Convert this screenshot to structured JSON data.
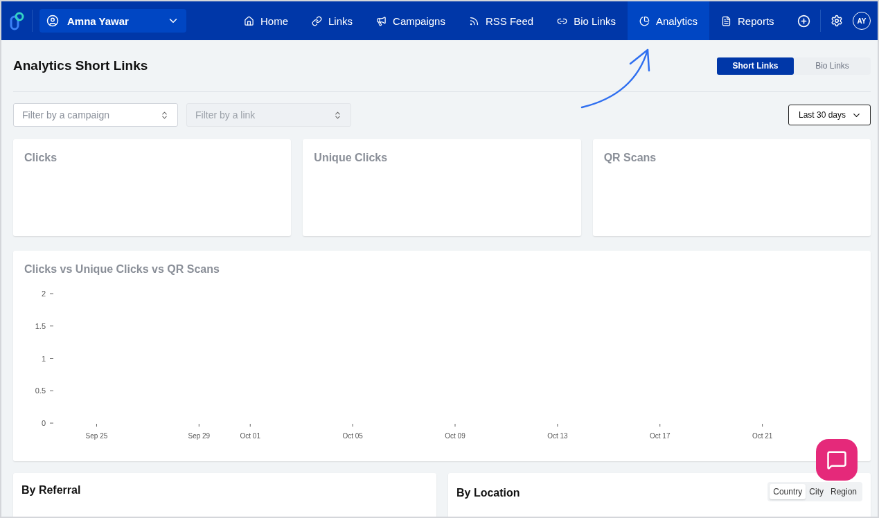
{
  "nav": {
    "account": "Amna Yawar",
    "avatar": "AY",
    "items": [
      {
        "label": "Home",
        "selected": false
      },
      {
        "label": "Links",
        "selected": false
      },
      {
        "label": "Campaigns",
        "selected": false
      },
      {
        "label": "RSS Feed",
        "selected": false
      },
      {
        "label": "Bio Links",
        "selected": false
      },
      {
        "label": "Analytics",
        "selected": true
      },
      {
        "label": "Reports",
        "selected": false
      }
    ]
  },
  "page": {
    "title": "Analytics Short Links",
    "toggle": [
      {
        "label": "Short Links",
        "selected": true
      },
      {
        "label": "Bio Links",
        "selected": false
      }
    ]
  },
  "filters": [
    {
      "placeholder": "Filter by a campaign",
      "disabled": false
    },
    {
      "placeholder": "Filter by a link",
      "disabled": true
    }
  ],
  "date_range": "Last 30 days",
  "stat_cards": [
    {
      "title": "Clicks"
    },
    {
      "title": "Unique Clicks"
    },
    {
      "title": "QR Scans"
    }
  ],
  "chart": {
    "title": "Clicks vs Unique Clicks vs QR Scans",
    "chart_data": {
      "type": "line",
      "ylim": [
        0,
        2
      ],
      "yticks": [
        0,
        0.5,
        1,
        1.5,
        2
      ],
      "categories": [
        null,
        "Sep 25",
        null,
        null,
        null,
        "Sep 29",
        null,
        "Oct 01",
        null,
        null,
        null,
        "Oct 05",
        null,
        null,
        null,
        "Oct 09",
        null,
        null,
        null,
        "Oct 13",
        null,
        null,
        null,
        "Oct 17",
        null,
        null,
        null,
        "Oct 21",
        null,
        null,
        null
      ]
    }
  },
  "referral": {
    "title": "By Referral"
  },
  "location": {
    "title": "By Location",
    "tabs": [
      {
        "label": "Country",
        "selected": true
      },
      {
        "label": "City",
        "selected": false
      },
      {
        "label": "Region",
        "selected": false
      }
    ]
  }
}
